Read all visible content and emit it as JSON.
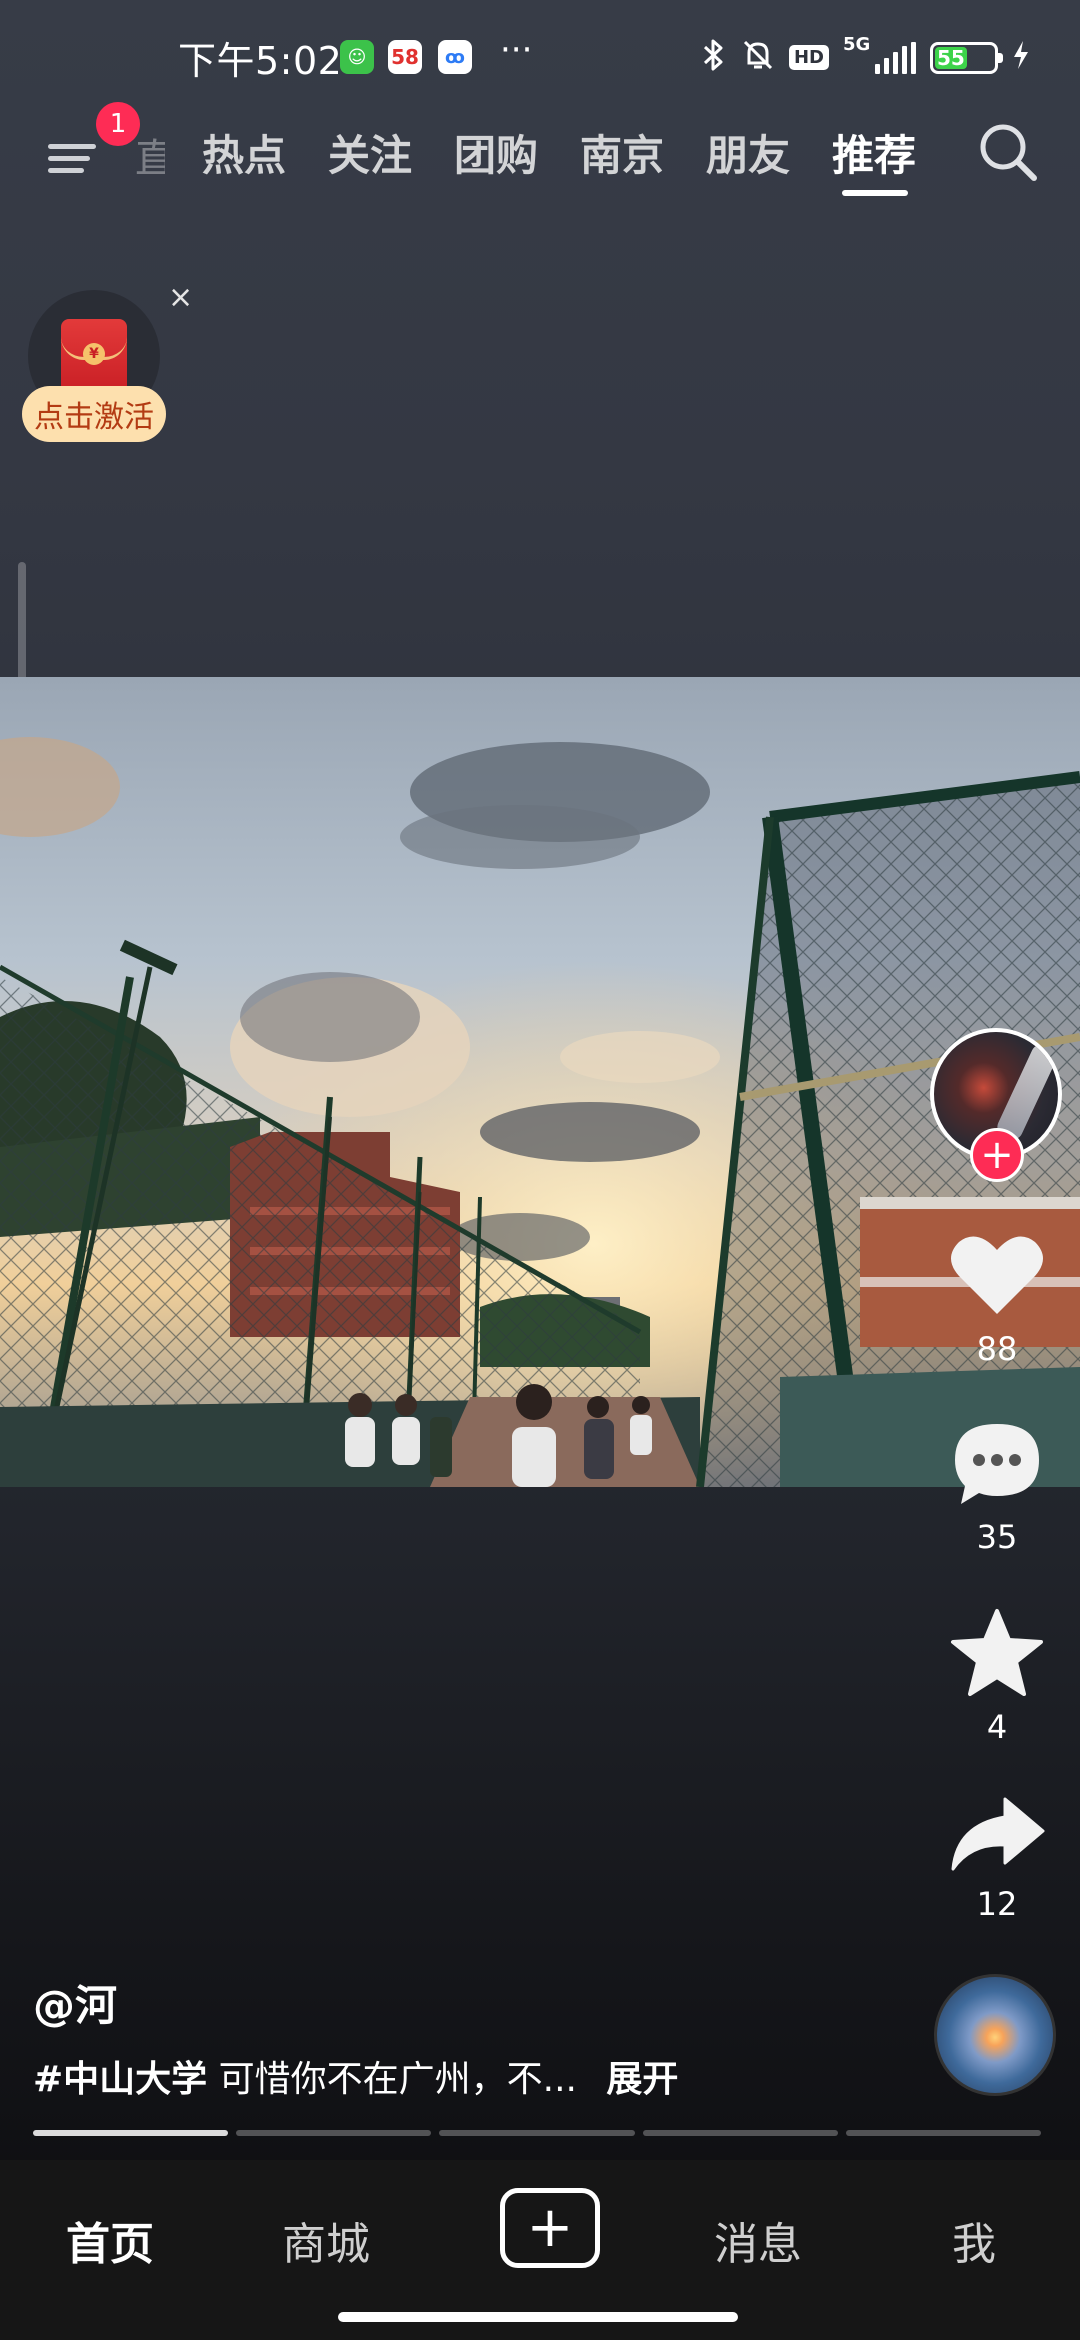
{
  "status_bar": {
    "time": "下午5:02",
    "app_icons": [
      "green-app-icon",
      "58-app-icon",
      "baidu-netdisk-icon"
    ],
    "app_58_label": "58",
    "more": "···",
    "hd": "HD",
    "network": "5G",
    "battery": "55"
  },
  "top_nav": {
    "notification_badge": "1",
    "partial_tab": "直播",
    "tabs": [
      "热点",
      "关注",
      "团购",
      "南京",
      "朋友",
      "推荐"
    ],
    "active_tab": "推荐"
  },
  "red_packet": {
    "label": "点击激活",
    "close": "×",
    "coin": "¥"
  },
  "actions": {
    "likes": "88",
    "comments": "35",
    "favorites": "4",
    "shares": "12"
  },
  "post": {
    "author": "@河",
    "hashtag": "#中山大学",
    "text": "可惜你不在广州，不...",
    "expand": "展开",
    "progress_segments": 5,
    "active_segment": 1
  },
  "bottom_nav": {
    "home": "首页",
    "mall": "商城",
    "messages": "消息",
    "me": "我",
    "add": "+"
  },
  "colors": {
    "accent": "#fe2c55",
    "battery": "#3dd34a",
    "badge_bg": "#fde0ae"
  }
}
